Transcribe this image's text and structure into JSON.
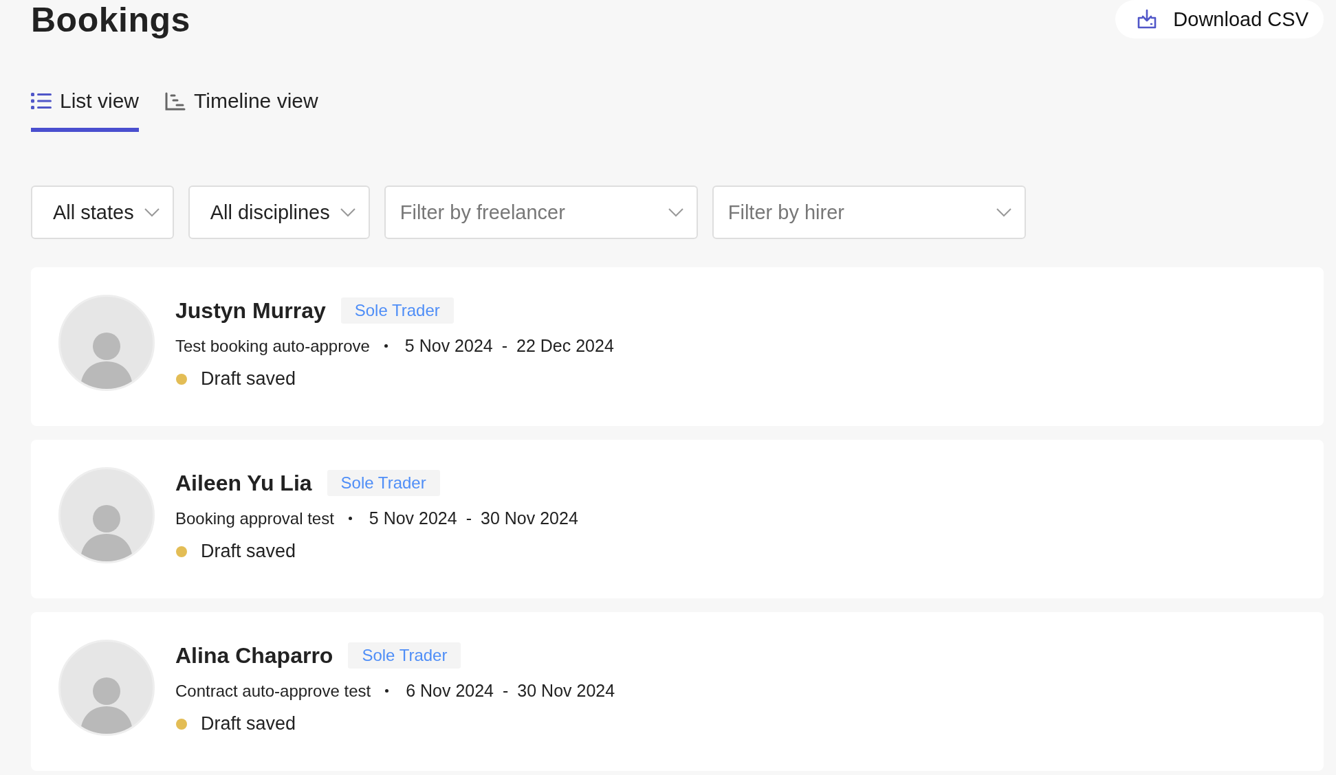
{
  "page": {
    "title": "Bookings"
  },
  "download_button": {
    "label": "Download CSV"
  },
  "tabs": [
    {
      "label": "List view",
      "kind": "list",
      "selected": true
    },
    {
      "label": "Timeline view",
      "kind": "timeline",
      "selected": false
    }
  ],
  "filters": [
    {
      "value": "All states"
    },
    {
      "value": "All disciplines"
    },
    {
      "placeholder": "Filter by freelancer"
    },
    {
      "placeholder": "Filter by hirer"
    }
  ],
  "bookings": [
    {
      "name": "Justyn Murray",
      "badge": "Sole Trader",
      "title": "Test booking auto-approve",
      "start": "5 Nov 2024",
      "separator": "-",
      "end": "22 Dec 2024",
      "status": "Draft saved",
      "color": "#e3bd55"
    },
    {
      "name": "Aileen Yu Lia",
      "badge": "Sole Trader",
      "title": "Booking approval test",
      "start": "5 Nov 2024",
      "separator": "-",
      "end": "30 Nov 2024",
      "status": "Draft saved",
      "color": "#e3bd55"
    },
    {
      "name": "Alina Chaparro",
      "badge": "Sole Trader",
      "title": "Contract auto-approve test",
      "start": "6 Nov 2024",
      "separator": "-",
      "end": "30 Nov 2024",
      "status": "Draft saved",
      "color": "#e3bd55"
    }
  ]
}
